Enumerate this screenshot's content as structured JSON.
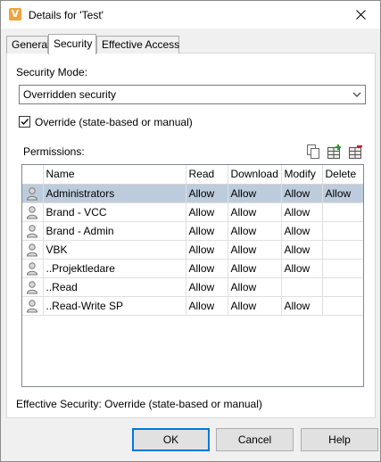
{
  "window": {
    "title": "Details for 'Test'",
    "app_icon_letter": "V"
  },
  "tabs": [
    {
      "label": "General"
    },
    {
      "label": "Security"
    },
    {
      "label": "Effective Access"
    }
  ],
  "security": {
    "mode_label": "Security Mode:",
    "mode_value": "Overridden security",
    "override_checked": true,
    "override_label": "Override (state-based or manual)",
    "permissions_label": "Permissions:",
    "effective_security": "Effective Security: Override (state-based or manual)"
  },
  "permissions": {
    "columns": [
      "Name",
      "Read",
      "Download",
      "Modify",
      "Delete"
    ],
    "rows": [
      {
        "name": "Administrators",
        "read": "Allow",
        "download": "Allow",
        "modify": "Allow",
        "delete": "Allow"
      },
      {
        "name": "Brand - VCC",
        "read": "Allow",
        "download": "Allow",
        "modify": "Allow",
        "delete": ""
      },
      {
        "name": "Brand - Admin",
        "read": "Allow",
        "download": "Allow",
        "modify": "Allow",
        "delete": ""
      },
      {
        "name": "VBK",
        "read": "Allow",
        "download": "Allow",
        "modify": "Allow",
        "delete": ""
      },
      {
        "name": "..Projektledare",
        "read": "Allow",
        "download": "Allow",
        "modify": "Allow",
        "delete": ""
      },
      {
        "name": "..Read",
        "read": "Allow",
        "download": "Allow",
        "modify": "",
        "delete": ""
      },
      {
        "name": "..Read-Write SP",
        "read": "Allow",
        "download": "Allow",
        "modify": "Allow",
        "delete": ""
      }
    ]
  },
  "buttons": {
    "ok": "OK",
    "cancel": "Cancel",
    "help": "Help"
  },
  "colors": {
    "selection": "#bcccdc",
    "default_button_border": "#0078d7",
    "app_icon": "#f3a23a"
  }
}
